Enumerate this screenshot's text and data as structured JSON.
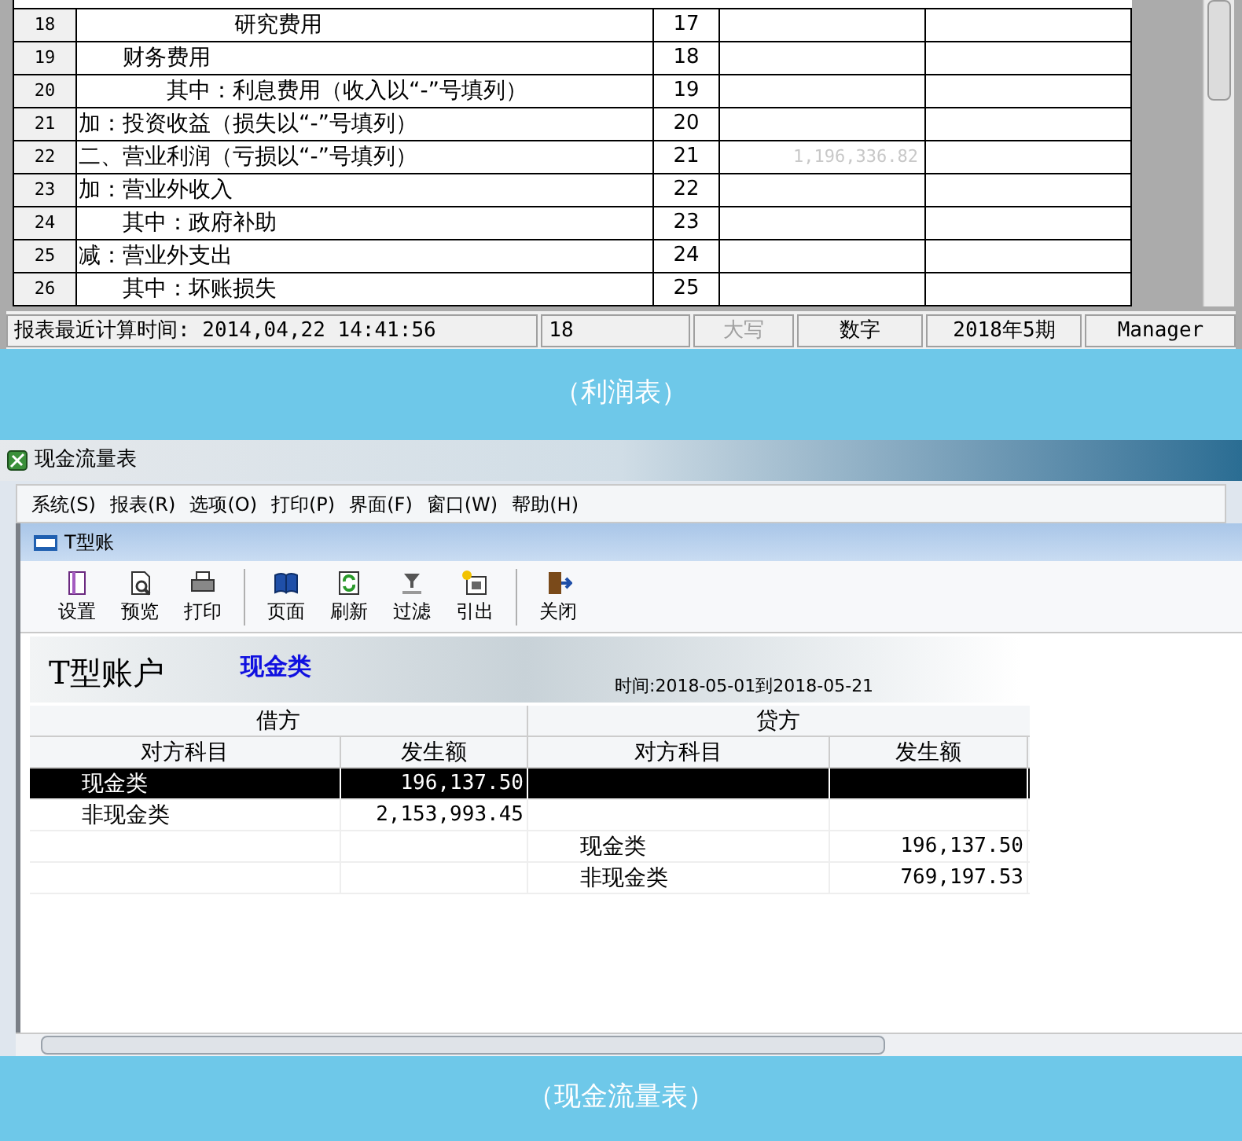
{
  "profit_report": {
    "rows": [
      {
        "number": "18",
        "item": "研究费用",
        "kind": "subdetail",
        "line": "17",
        "value": ""
      },
      {
        "number": "19",
        "item": "财务费用",
        "kind": "item",
        "line": "18",
        "value": ""
      },
      {
        "number": "20",
        "item": "其中：利息费用（收入以“-”号填列）",
        "kind": "detail",
        "line": "19",
        "value": ""
      },
      {
        "number": "21",
        "item": "加：投资收益（损失以“-”号填列）",
        "kind": "section",
        "line": "20",
        "value": ""
      },
      {
        "number": "22",
        "item": "二、营业利润（亏损以“-”号填列）",
        "kind": "section",
        "line": "21",
        "value": "1,196,336.82"
      },
      {
        "number": "23",
        "item": "加：营业外收入",
        "kind": "section",
        "line": "22",
        "value": ""
      },
      {
        "number": "24",
        "item": "其中：政府补助",
        "kind": "item",
        "line": "23",
        "value": ""
      },
      {
        "number": "25",
        "item": "减：营业外支出",
        "kind": "section",
        "line": "24",
        "value": ""
      },
      {
        "number": "26",
        "item": "其中：坏账损失",
        "kind": "item",
        "line": "25",
        "value": ""
      }
    ],
    "status_bar": [
      {
        "text": "报表最近计算时间: 2014,04,22 14:41:56",
        "disabled": false
      },
      {
        "text": "18",
        "disabled": false
      },
      {
        "text": "大写",
        "disabled": true
      },
      {
        "text": "数字",
        "disabled": false
      },
      {
        "text": "2018年5期",
        "disabled": false
      },
      {
        "text": "Manager",
        "disabled": false
      }
    ],
    "caption": "（利润表）"
  },
  "cash_flow": {
    "window": {
      "title": "现金流量表"
    },
    "menu": [
      "系统(S)",
      "报表(R)",
      "选项(O)",
      "打印(P)",
      "界面(F)",
      "窗口(W)",
      "帮助(H)"
    ],
    "subwindow": {
      "title": "T型账"
    },
    "toolbar": [
      {
        "label": "设置",
        "kind": "setup"
      },
      {
        "label": "预览",
        "kind": "preview"
      },
      {
        "label": "打印",
        "kind": "print"
      },
      {
        "label": "页面",
        "kind": "page"
      },
      {
        "label": "刷新",
        "kind": "refresh"
      },
      {
        "label": "过滤",
        "kind": "filter"
      },
      {
        "label": "引出",
        "kind": "export"
      },
      {
        "label": "关闭",
        "kind": "close"
      }
    ],
    "banner": {
      "title": "T型账户",
      "category": "现金类",
      "period": "时间:2018-05-01到2018-05-21"
    },
    "table": {
      "groups": [
        "借方",
        "贷方"
      ],
      "columns": [
        "对方科目",
        "发生额",
        "对方科目",
        "发生额"
      ],
      "rows": [
        {
          "cells": [
            "现金类",
            "196,137.50",
            "",
            ""
          ],
          "selected": true
        },
        {
          "cells": [
            "非现金类",
            "2,153,993.45",
            "",
            ""
          ],
          "selected": false
        },
        {
          "cells": [
            "",
            "",
            "现金类",
            "196,137.50"
          ],
          "selected": false
        },
        {
          "cells": [
            "",
            "",
            "非现金类",
            "769,197.53"
          ],
          "selected": false
        }
      ]
    },
    "caption": "（现金流量表）"
  }
}
